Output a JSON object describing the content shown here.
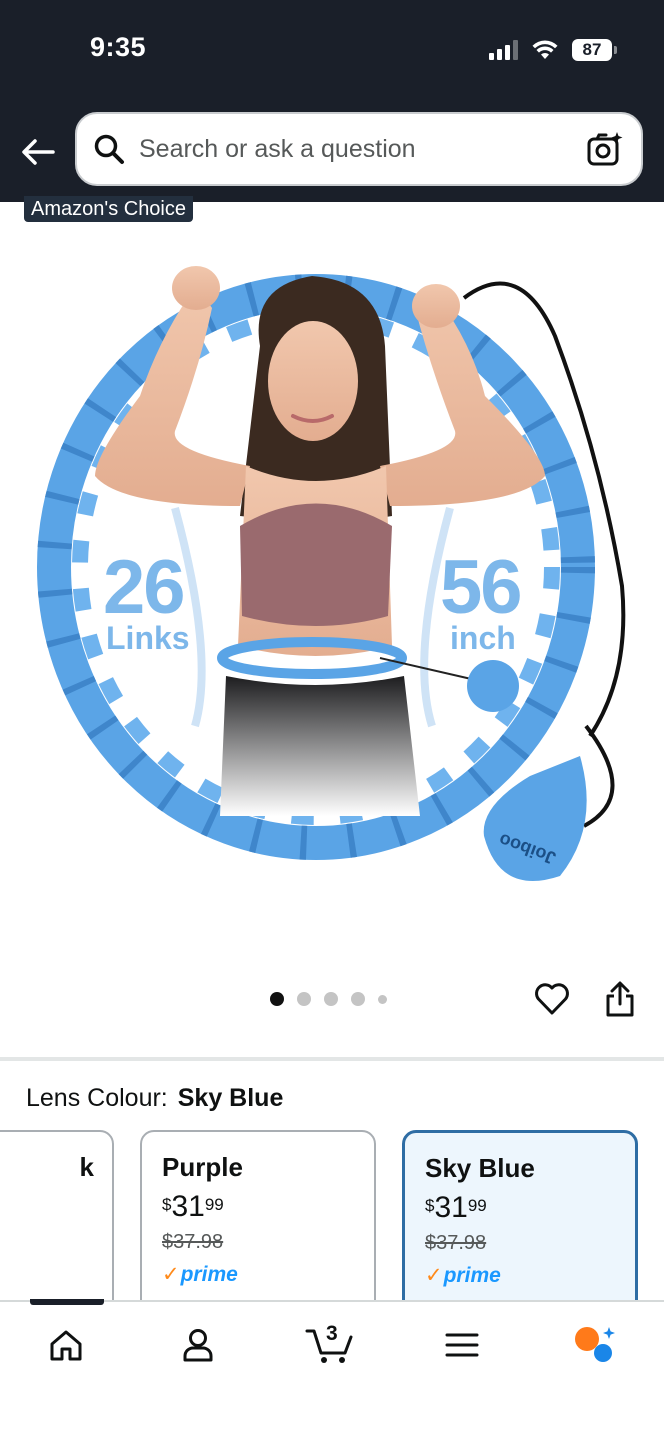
{
  "status_bar": {
    "time": "9:35",
    "battery": "87"
  },
  "header": {
    "search_placeholder": "Search or ask a question",
    "back_icon": "arrow-left-icon",
    "camera_icon": "camera-search-icon"
  },
  "badge": {
    "label": "Amazon's Choice"
  },
  "product_image": {
    "left_number": "26",
    "left_unit": "Links",
    "right_number": "56",
    "right_unit": "inch",
    "brand_mark": "Joiboo",
    "image_index": 1,
    "image_count": 5
  },
  "variation": {
    "label": "Lens Colour:",
    "selected_value": "Sky Blue",
    "options": [
      {
        "name": "k",
        "selected": false
      },
      {
        "name": "Purple",
        "price_symbol": "$",
        "price_whole": "31",
        "price_fraction": "99",
        "list_price": "$37.98",
        "prime": "prime",
        "selected": false
      },
      {
        "name": "Sky Blue",
        "price_symbol": "$",
        "price_whole": "31",
        "price_fraction": "99",
        "list_price": "$37.98",
        "prime": "prime",
        "selected": true
      }
    ]
  },
  "bottom_nav": {
    "cart_count": "3",
    "items": [
      "home-icon",
      "account-icon",
      "cart-icon",
      "menu-icon",
      "rufus-assistant-icon"
    ]
  },
  "colors": {
    "header_bg": "#1a1f29",
    "selected_border": "#2e6da4",
    "selected_bg": "#edf6fd",
    "prime_blue": "#1a98ff",
    "prime_tick": "#ff8a1a",
    "hoop_blue": "#5aa4e6"
  }
}
